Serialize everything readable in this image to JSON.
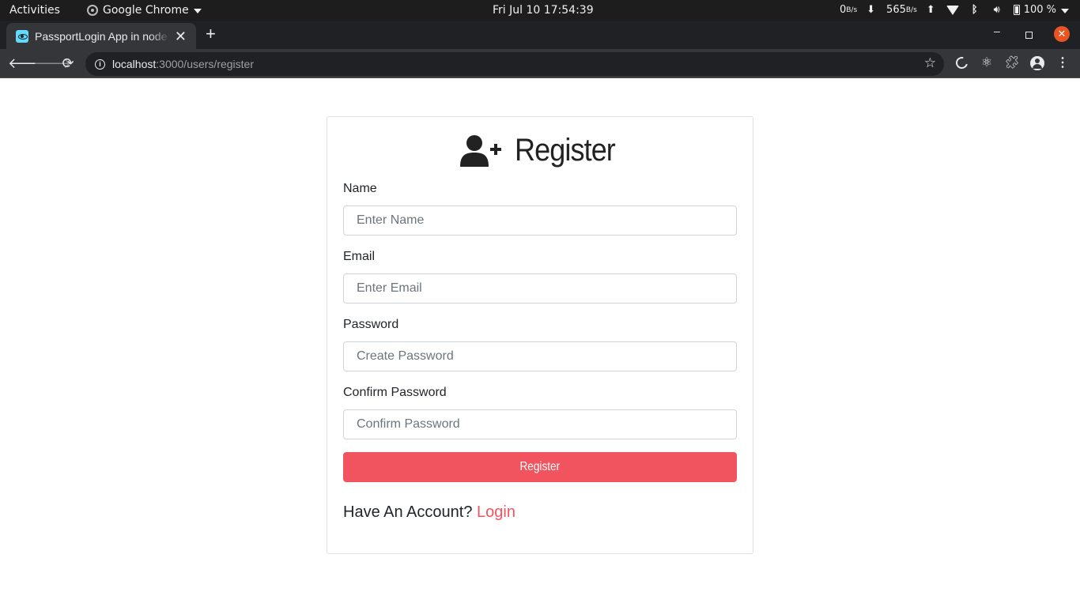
{
  "system_bar": {
    "activities": "Activities",
    "app_name": "Google Chrome",
    "clock": "Fri Jul 10  17:54:39",
    "net_down_value": "0",
    "net_down_unit": "B/s",
    "net_up_value": "565",
    "net_up_unit": "B/s",
    "battery": "100 %"
  },
  "browser": {
    "tab_title": "PassportLogin App in node",
    "url_host": "localhost",
    "url_rest": ":3000/users/register"
  },
  "page": {
    "title": "Register",
    "fields": [
      {
        "label": "Name",
        "placeholder": "Enter Name",
        "type": "text"
      },
      {
        "label": "Email",
        "placeholder": "Enter Email",
        "type": "email"
      },
      {
        "label": "Password",
        "placeholder": "Create Password",
        "type": "password"
      },
      {
        "label": "Confirm Password",
        "placeholder": "Confirm Password",
        "type": "password"
      }
    ],
    "submit_label": "Register",
    "footer_text": "Have An Account?",
    "footer_link": "Login"
  },
  "colors": {
    "accent": "#f2545f",
    "topbar": "#1d1d1d",
    "tabstrip": "#202124",
    "toolbar": "#35363a"
  }
}
